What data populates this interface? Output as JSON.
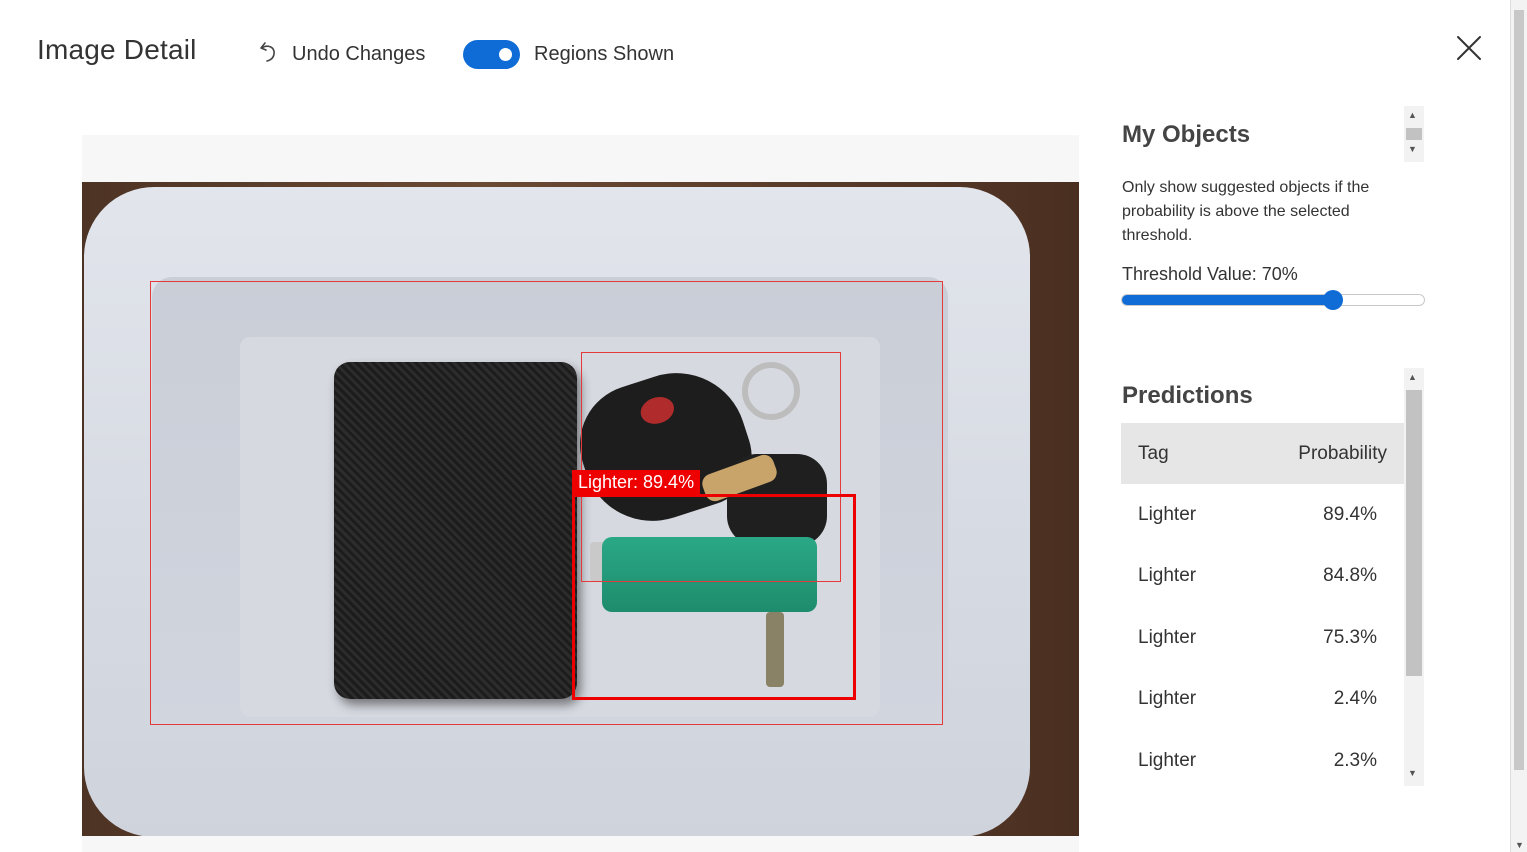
{
  "header": {
    "title": "Image Detail",
    "undo_label": "Undo Changes",
    "regions_toggle_label": "Regions Shown",
    "regions_toggle_on": true
  },
  "image": {
    "region_label": "Lighter: 89.4%"
  },
  "my_objects": {
    "title": "My Objects",
    "description": "Only show suggested objects if the probability is above the selected threshold.",
    "threshold_label": "Threshold Value: 70%",
    "threshold_value": 0.7
  },
  "predictions": {
    "title": "Predictions",
    "columns": [
      "Tag",
      "Probability"
    ],
    "rows": [
      {
        "tag": "Lighter",
        "probability": "89.4%"
      },
      {
        "tag": "Lighter",
        "probability": "84.8%"
      },
      {
        "tag": "Lighter",
        "probability": "75.3%"
      },
      {
        "tag": "Lighter",
        "probability": "2.4%"
      },
      {
        "tag": "Lighter",
        "probability": "2.3%"
      }
    ]
  },
  "colors": {
    "accent": "#0f6cd6",
    "region": "#ee0000"
  },
  "icons": {
    "undo": "undo-icon",
    "close": "close-icon"
  }
}
